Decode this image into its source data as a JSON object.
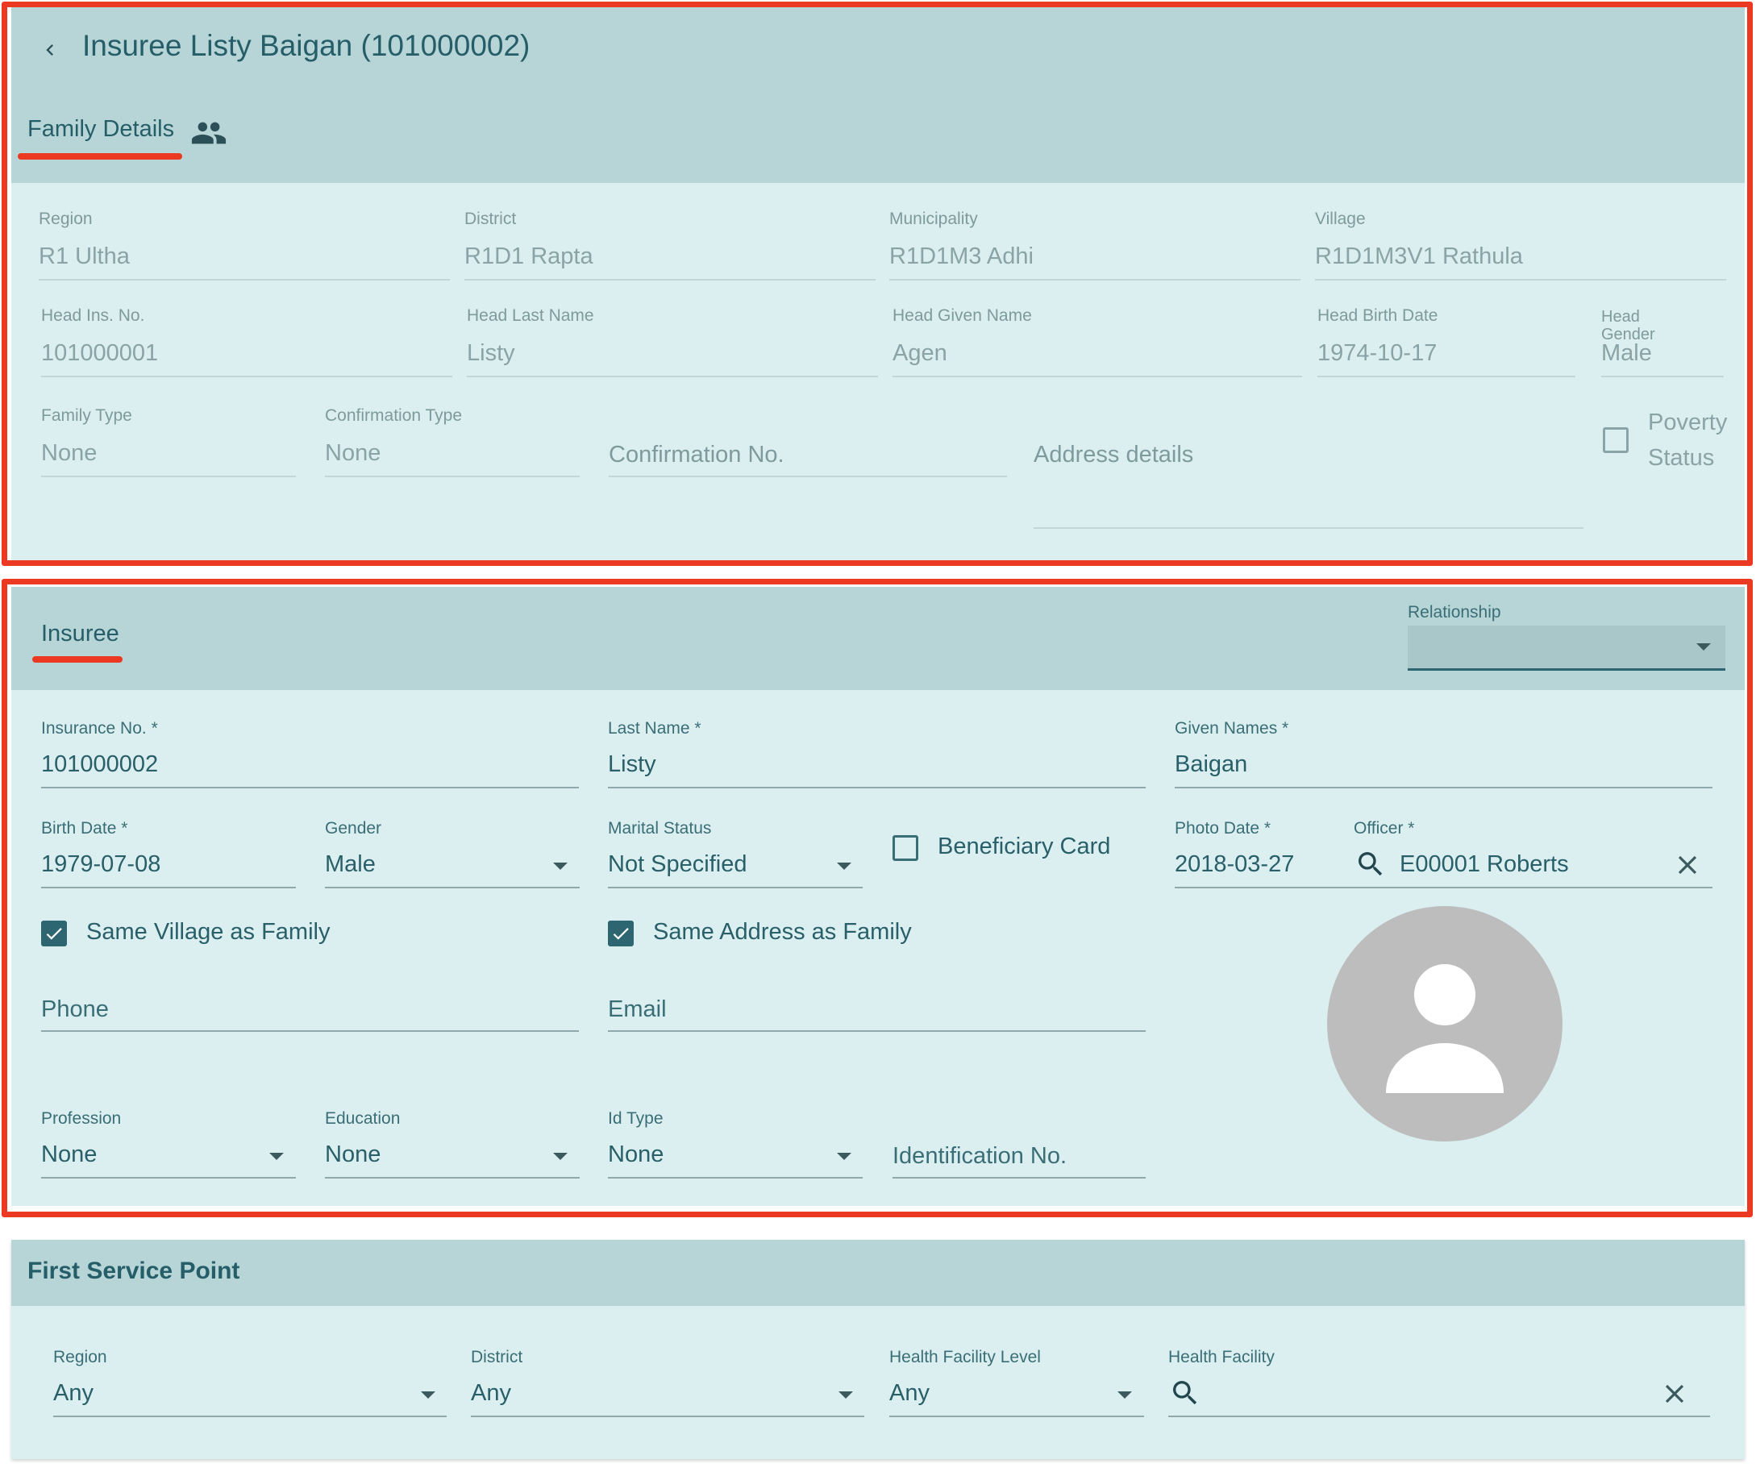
{
  "header": {
    "title": "Insuree Listy Baigan (101000002)",
    "back_icon": "chevron-left-icon"
  },
  "family": {
    "section_label": "Family Details",
    "section_icon": "people-icon",
    "region": {
      "label": "Region",
      "value": "R1 Ultha"
    },
    "district": {
      "label": "District",
      "value": "R1D1 Rapta"
    },
    "municipality": {
      "label": "Municipality",
      "value": "R1D1M3 Adhi"
    },
    "village": {
      "label": "Village",
      "value": "R1D1M3V1 Rathula"
    },
    "head_ins_no": {
      "label": "Head Ins. No.",
      "value": "101000001"
    },
    "head_last_name": {
      "label": "Head Last Name",
      "value": "Listy"
    },
    "head_given_name": {
      "label": "Head Given Name",
      "value": "Agen"
    },
    "head_birth_date": {
      "label": "Head Birth Date",
      "value": "1974-10-17"
    },
    "head_gender": {
      "label_line1": "Head",
      "label_line2": "Gender",
      "value": "Male"
    },
    "family_type": {
      "label": "Family Type",
      "value": "None"
    },
    "confirmation_type": {
      "label": "Confirmation Type",
      "value": "None"
    },
    "confirmation_no": {
      "placeholder": "Confirmation No."
    },
    "address_details": {
      "placeholder": "Address details"
    },
    "poverty_status": {
      "label_line1": "Poverty",
      "label_line2": "Status",
      "checked": false
    }
  },
  "insuree": {
    "section_label": "Insuree",
    "relationship": {
      "label": "Relationship",
      "value": ""
    },
    "insurance_no": {
      "label": "Insurance No. *",
      "value": "101000002"
    },
    "last_name": {
      "label": "Last Name *",
      "value": "Listy"
    },
    "given_names": {
      "label": "Given Names *",
      "value": "Baigan"
    },
    "birth_date": {
      "label": "Birth Date *",
      "value": "1979-07-08"
    },
    "gender": {
      "label": "Gender",
      "value": "Male"
    },
    "marital_status": {
      "label": "Marital Status",
      "value": "Not Specified"
    },
    "beneficiary_card": {
      "label": "Beneficiary Card",
      "checked": false
    },
    "photo_date": {
      "label": "Photo Date *",
      "value": "2018-03-27"
    },
    "officer": {
      "label": "Officer *",
      "value": "E00001 Roberts"
    },
    "same_village": {
      "label": "Same Village as Family",
      "checked": true
    },
    "same_address": {
      "label": "Same Address as Family",
      "checked": true
    },
    "phone": {
      "placeholder": "Phone"
    },
    "email": {
      "placeholder": "Email"
    },
    "profession": {
      "label": "Profession",
      "value": "None"
    },
    "education": {
      "label": "Education",
      "value": "None"
    },
    "id_type": {
      "label": "Id Type",
      "value": "None"
    },
    "identification_no": {
      "placeholder": "Identification No."
    },
    "photo_icon": "person-avatar-icon"
  },
  "service_point": {
    "section_label": "First Service Point",
    "region": {
      "label": "Region",
      "value": "Any"
    },
    "district": {
      "label": "District",
      "value": "Any"
    },
    "hf_level": {
      "label": "Health Facility Level",
      "value": "Any"
    },
    "health_facility": {
      "label": "Health Facility",
      "value": ""
    }
  },
  "colors": {
    "header_bg": "#b7d5d7",
    "panel_bg": "#dceff0",
    "accent": "#255e68",
    "annotation": "#ec3a22"
  }
}
